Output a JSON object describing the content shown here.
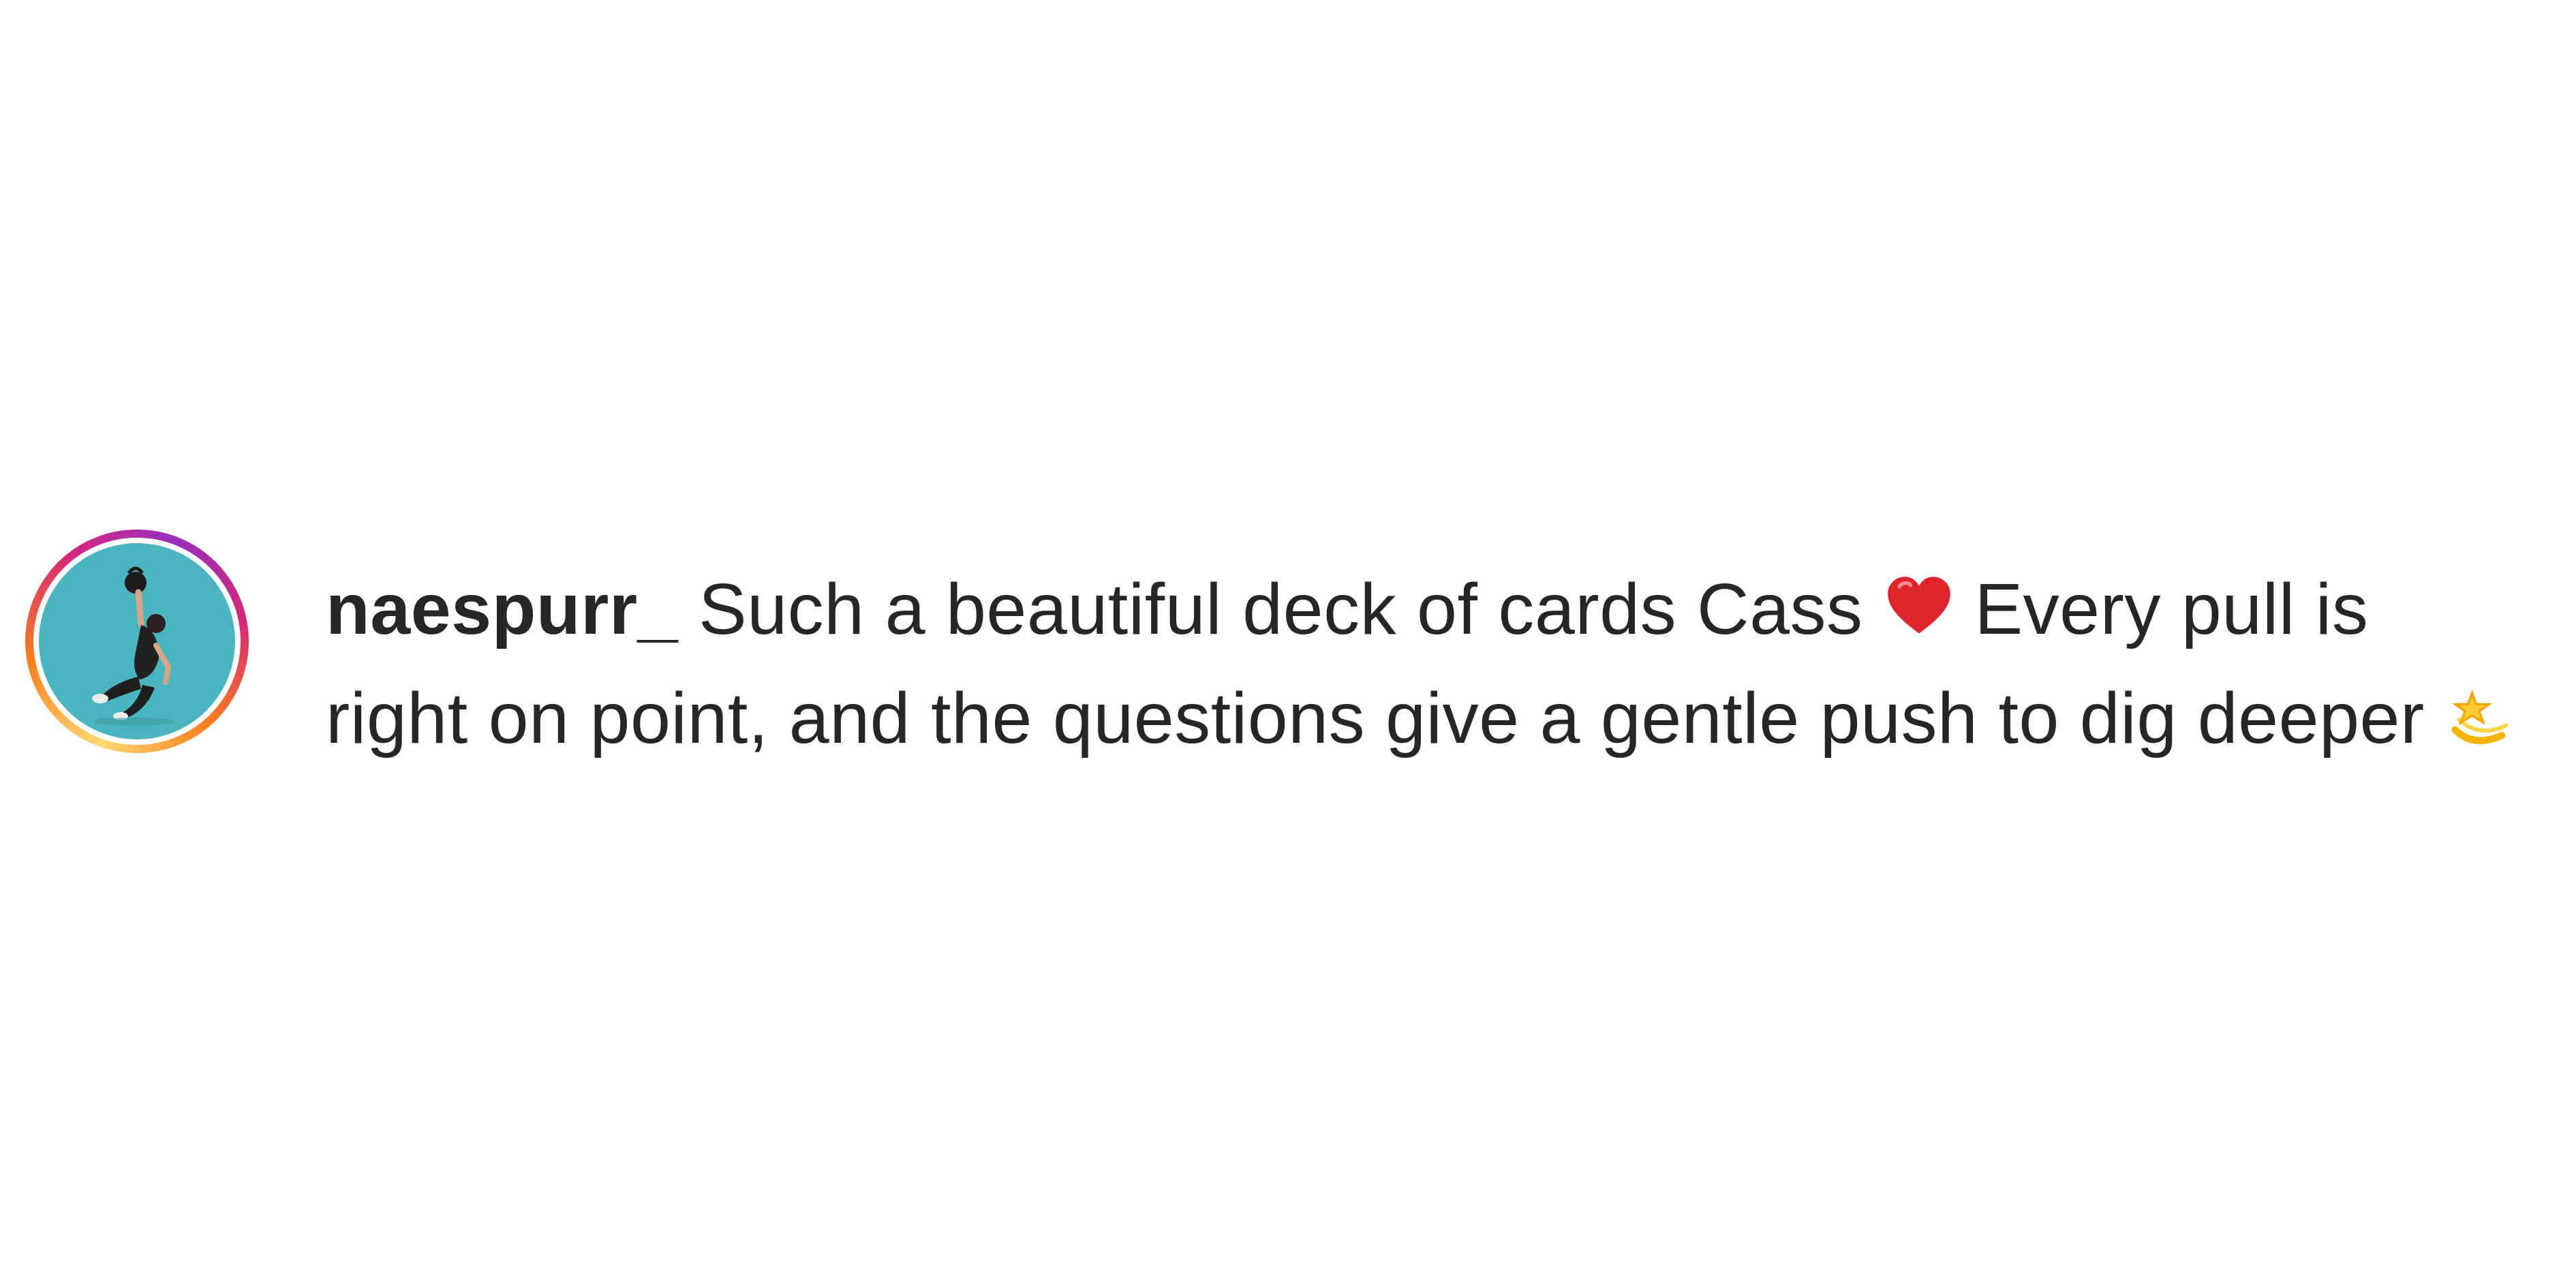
{
  "comment": {
    "username": "naespurr_",
    "text_part1": "Such a beautiful deck of cards Cass",
    "emoji_heart": "heart-icon",
    "text_part2": "Every pull is right on point, and the questions give a gentle push to dig deeper",
    "emoji_dizzy": "dizzy-star-icon"
  },
  "avatar": {
    "story_ring": true,
    "background_color": "#4bb5bf",
    "icon": "user-avatar-photo"
  },
  "colors": {
    "text": "#262626",
    "ring_gradient": [
      "#feda75",
      "#fa7e1e",
      "#d62976",
      "#962fbf"
    ],
    "heart": "#e0242c",
    "dizzy": "#f4b400"
  }
}
